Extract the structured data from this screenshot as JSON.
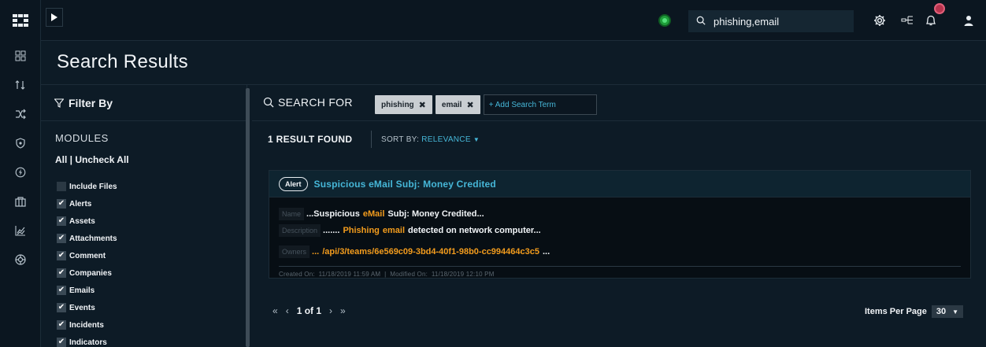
{
  "topbar": {
    "search_value": "phishing,email"
  },
  "page": {
    "title": "Search Results"
  },
  "filter": {
    "heading": "Filter By",
    "modules_label": "MODULES",
    "all_label": "All",
    "separator": " | ",
    "uncheck_all_label": "Uncheck All",
    "items": [
      {
        "label": "Include Files",
        "checked": false
      },
      {
        "label": "Alerts",
        "checked": true
      },
      {
        "label": "Assets",
        "checked": true
      },
      {
        "label": "Attachments",
        "checked": true
      },
      {
        "label": "Comment",
        "checked": true
      },
      {
        "label": "Companies",
        "checked": true
      },
      {
        "label": "Emails",
        "checked": true
      },
      {
        "label": "Events",
        "checked": true
      },
      {
        "label": "Incidents",
        "checked": true
      },
      {
        "label": "Indicators",
        "checked": true
      }
    ]
  },
  "search": {
    "label": "SEARCH FOR",
    "terms": [
      "phishing",
      "email"
    ],
    "add_term_placeholder": "+ Add Search Term"
  },
  "results": {
    "count_label": "1 RESULT FOUND",
    "sort_label": "SORT BY:",
    "sort_value": "RELEVANCE",
    "items": [
      {
        "type_label": "Alert",
        "title": "Suspicious eMail Subj: Money Credited",
        "name_key": "Name",
        "name_prefix": "...Suspicious",
        "name_highlight": "eMail",
        "name_suffix": "Subj: Money Credited...",
        "description_key": "Description",
        "description_prefix": ".......",
        "description_highlight_1": "Phishing",
        "description_highlight_2": "email",
        "description_suffix": "detected on network computer...",
        "owners_key": "Owners",
        "owners_prefix": "...",
        "owners_value": "/api/3/teams/6e569c09-3bd4-40f1-98b0-cc994464c3c5",
        "owners_suffix": "...",
        "meta": "Created On:  11/18/2019 11:59 AM  |  Modified On:  11/18/2019 12:10 PM"
      }
    ]
  },
  "pagination": {
    "page_text": "1 of 1",
    "items_per_page_label": "Items Per Page",
    "items_per_page_value": "30"
  },
  "colors": {
    "accent": "#46b7d8",
    "highlight": "#f39c1d",
    "status_ok": "#1f9e3a",
    "notification": "#b8334d"
  }
}
